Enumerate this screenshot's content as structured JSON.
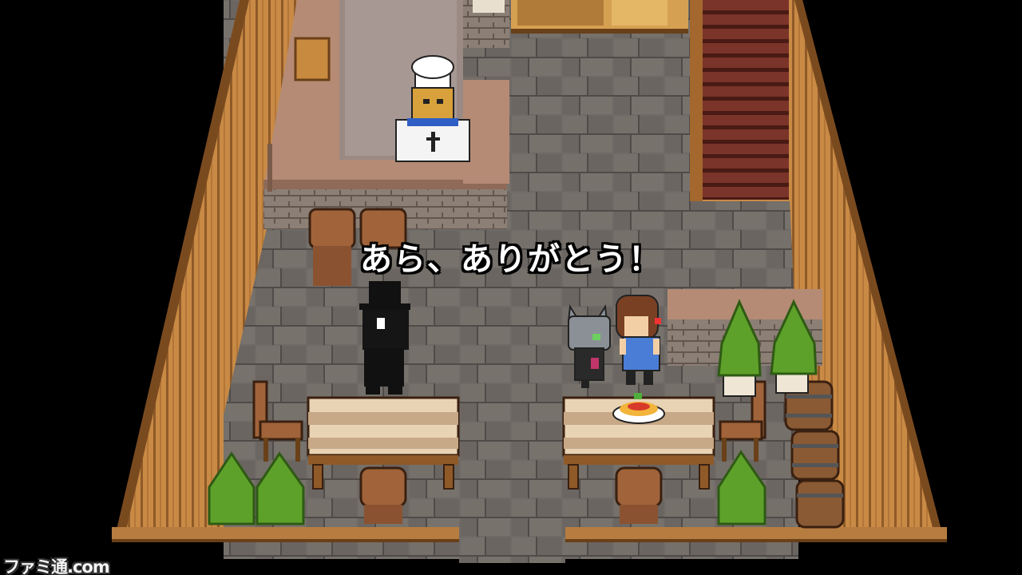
{
  "dialogue": {
    "text": "あら、ありがとう！"
  },
  "watermark": {
    "text": "ファミ通.com"
  },
  "colors": {
    "background": "#000000",
    "wood_wall": "#c98a45",
    "stone_floor": "#6f6a66",
    "counter": "#b58b75",
    "table_top": "#e9d3b5",
    "staircase": "#6a2b22",
    "chair": "#a0633a",
    "plant": "#5ea12a"
  },
  "icons": {
    "chef": "bear-chef-sprite",
    "customer": "top-hat-shadow-sprite",
    "cat": "gray-cat-sprite",
    "waitress": "brown-hair-girl-sprite",
    "food": "spaghetti-plate-icon"
  }
}
